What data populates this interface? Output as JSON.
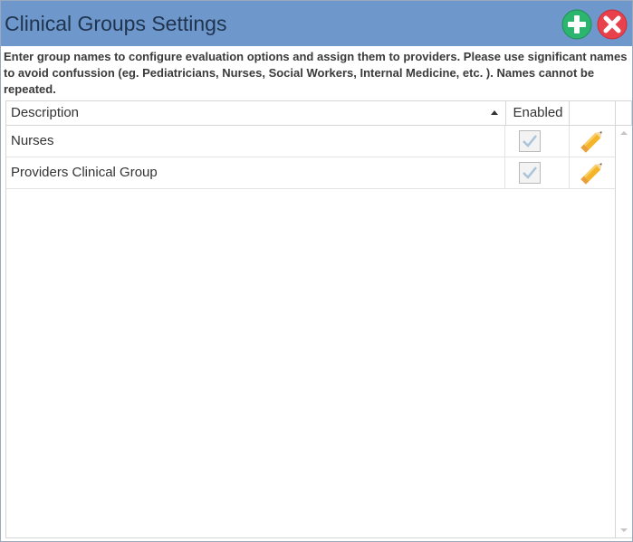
{
  "window": {
    "title": "Clinical Groups Settings",
    "add_icon": "plus-circle-icon",
    "close_icon": "x-circle-icon",
    "colors": {
      "titlebar": "#6e98cc",
      "add": "#2bb56f",
      "close": "#e9414c"
    }
  },
  "instructions": "Enter group names to configure evaluation options and assign them to providers. Please use significant names to avoid confussion (eg. Pediatricians, Nurses, Social Workers, Internal Medicine, etc. ). Names cannot be repeated.",
  "grid": {
    "columns": {
      "description": "Description",
      "enabled": "Enabled"
    },
    "sort": {
      "column": "description",
      "direction": "ascending"
    },
    "rows": [
      {
        "description": "Nurses",
        "enabled": true,
        "edit_icon": "pencil-icon"
      },
      {
        "description": "Providers Clinical Group",
        "enabled": true,
        "edit_icon": "pencil-icon"
      }
    ]
  }
}
